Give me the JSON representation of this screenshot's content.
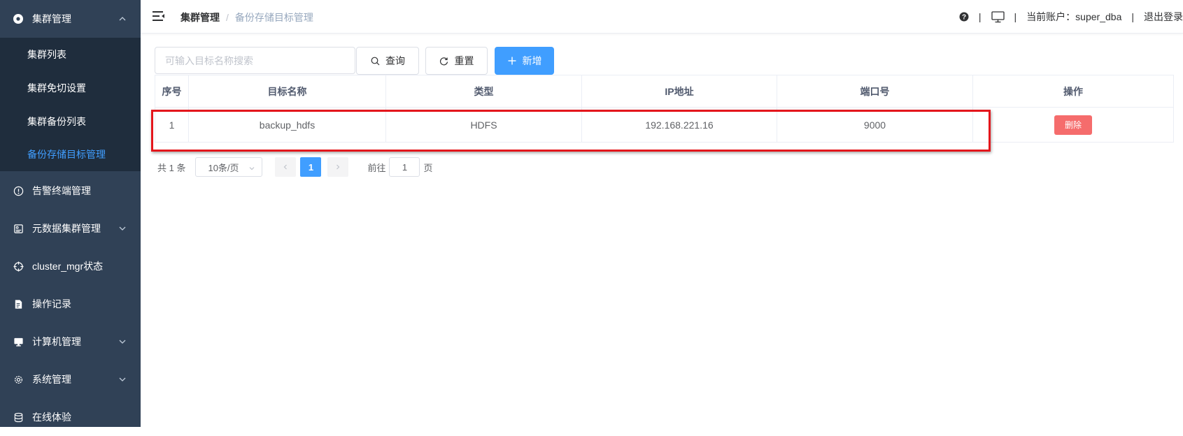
{
  "sidebar": {
    "group": {
      "label": "集群管理",
      "icon": "cluster-icon",
      "expanded": true
    },
    "submenu": [
      {
        "label": "集群列表"
      },
      {
        "label": "集群免切设置"
      },
      {
        "label": "集群备份列表"
      },
      {
        "label": "备份存储目标管理",
        "active": true
      }
    ],
    "items": [
      {
        "label": "告警终端管理",
        "icon": "alert-circle-icon",
        "has_arrow": false
      },
      {
        "label": "元数据集群管理",
        "icon": "metadata-icon",
        "has_arrow": true
      },
      {
        "label": "cluster_mgr状态",
        "icon": "crosshair-icon",
        "has_arrow": false
      },
      {
        "label": "操作记录",
        "icon": "document-edit-icon",
        "has_arrow": false
      },
      {
        "label": "计算机管理",
        "icon": "monitor-icon",
        "has_arrow": true
      },
      {
        "label": "系统管理",
        "icon": "gear-icon",
        "has_arrow": true
      },
      {
        "label": "在线体验",
        "icon": "database-icon",
        "has_arrow": false
      }
    ],
    "colors": {
      "background": "#304156",
      "submenu_background": "#1f2d3d",
      "active_text": "#409eff"
    }
  },
  "header": {
    "breadcrumb": {
      "home": "集群管理",
      "separator": "/",
      "current": "备份存储目标管理"
    },
    "separator": "|",
    "account_label": "当前账户：super_dba",
    "logout_label": "退出登录"
  },
  "toolbar": {
    "search_placeholder": "可输入目标名称搜索",
    "search_value": "",
    "query_label": "查询",
    "reset_label": "重置",
    "add_label": "新增"
  },
  "table": {
    "columns": [
      "序号",
      "目标名称",
      "类型",
      "IP地址",
      "端口号",
      "操作"
    ],
    "rows": [
      {
        "index": "1",
        "name": "backup_hdfs",
        "type": "HDFS",
        "ip": "192.168.221.16",
        "port": "9000",
        "action": "删除"
      }
    ]
  },
  "pagination": {
    "total_label": "共 1 条",
    "page_size_label": "10条/页",
    "current_page": "1",
    "goto_prefix": "前往",
    "goto_value": "1",
    "goto_suffix": "页"
  },
  "colors": {
    "primary": "#409eff",
    "danger": "#f56c6c",
    "highlight": "#e4161c"
  }
}
